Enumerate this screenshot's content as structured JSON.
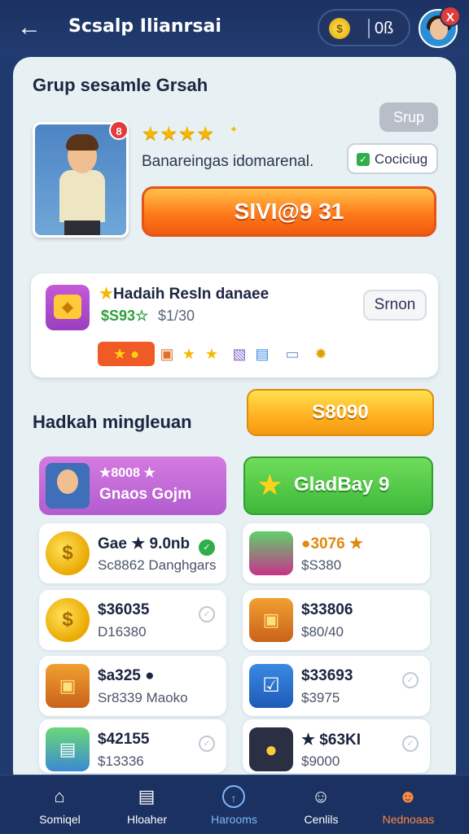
{
  "header": {
    "title": "Scsalp Ilianrsai",
    "coin_value": "0ß",
    "notif": "X"
  },
  "section1": {
    "title": "Grup sesamle Grsah",
    "small_button": "Srup",
    "rating": "★★★★",
    "description": "Banareingas idomarenal.",
    "checkbox_label": "Cociciug",
    "hero_badge": "8",
    "main_button": "SIVI@9 31"
  },
  "reward_card": {
    "title": "Hadaih Resln danaee",
    "price": "$S93☆",
    "old_price": "$1/30",
    "button": "Srnon"
  },
  "section2": {
    "title": "Hadkah mingleuan",
    "button": "S8090"
  },
  "promo_purple": {
    "line1": "★8008 ★",
    "line2": "Gnaos Gojm"
  },
  "promo_green": {
    "label": "GladBay 9"
  },
  "items": [
    {
      "price": "Gae ★ 9.0nb",
      "sub": "Sc8862 Danghgars",
      "checked": true
    },
    {
      "price": "●3076 ★",
      "sub": "$S380",
      "checked": false
    },
    {
      "price": "$36035",
      "sub": "D16380",
      "checked": false
    },
    {
      "price": "$33806",
      "sub": "$80/40",
      "checked": false
    },
    {
      "price": "$a325 ●",
      "sub": "Sr8339 Maoko",
      "checked": false
    },
    {
      "price": "$33693",
      "sub": "$3975",
      "checked": false
    },
    {
      "price": "$42155",
      "sub": "$13336",
      "checked": false
    },
    {
      "price": "★ $63KI",
      "sub": "$9000",
      "checked": false
    }
  ],
  "tabs": [
    {
      "label": "Somiqel",
      "icon": "home-icon"
    },
    {
      "label": "Hloaher",
      "icon": "store-icon"
    },
    {
      "label": "Harooms",
      "icon": "compass-icon"
    },
    {
      "label": "Cenlils",
      "icon": "profile-icon"
    },
    {
      "label": "Nednoaas",
      "icon": "chat-icon"
    }
  ],
  "colors": {
    "accent_orange": "#ff7a1a",
    "active_tab": "#7fb6ff",
    "highlight_tab": "#ff8a3d"
  }
}
